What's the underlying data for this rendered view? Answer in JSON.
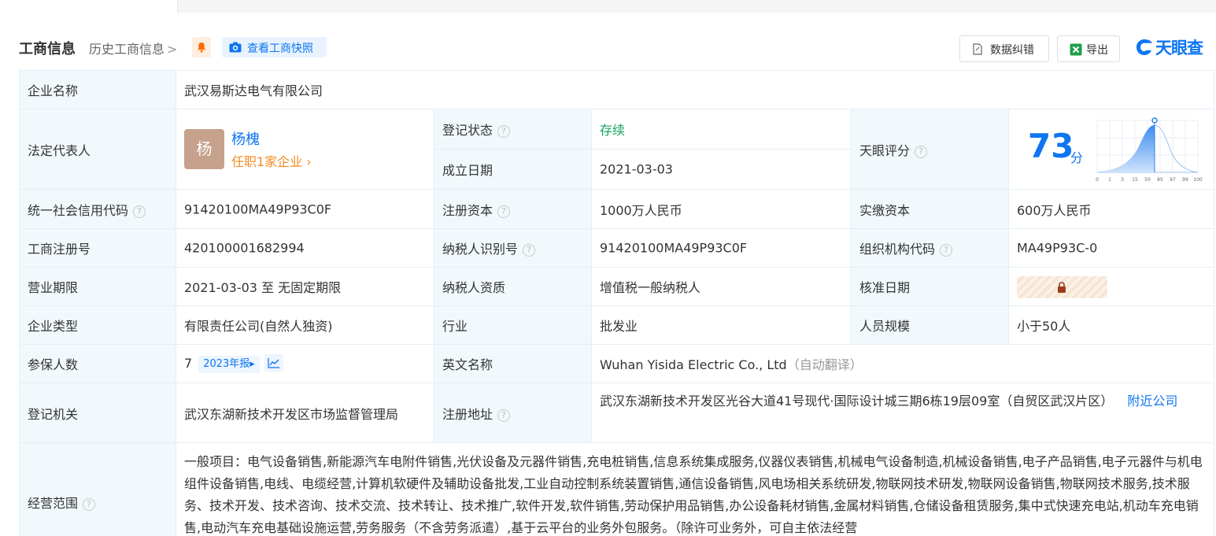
{
  "header": {
    "title": "工商信息",
    "history_link": "历史工商信息",
    "history_chevron": ">",
    "snapshot_button": "查看工商快照",
    "data_correction_button": "数据纠错",
    "export_button": "导出",
    "logo_text": "天眼查"
  },
  "rows": {
    "company_name": {
      "label": "企业名称",
      "value": "武汉易斯达电气有限公司"
    },
    "legal_rep": {
      "label": "法定代表人",
      "avatar_char": "杨",
      "name": "杨槐",
      "positions": "任职1家企业",
      "positions_chevron": "›"
    },
    "reg_status": {
      "label": "登记状态",
      "value": "存续"
    },
    "established": {
      "label": "成立日期",
      "value": "2021-03-03"
    },
    "tianyan_score": {
      "label": "天眼评分",
      "score": "73",
      "unit": "分",
      "axis_ticks": [
        "0",
        "1",
        "3",
        "15",
        "50",
        "85",
        "97",
        "99",
        "100"
      ]
    },
    "credit_code": {
      "label": "统一社会信用代码",
      "value": "91420100MA49P93C0F"
    },
    "reg_capital": {
      "label": "注册资本",
      "value": "1000万人民币"
    },
    "paid_capital": {
      "label": "实缴资本",
      "value": "600万人民币"
    },
    "reg_number": {
      "label": "工商注册号",
      "value": "420100001682994"
    },
    "taxpayer_id": {
      "label": "纳税人识别号",
      "value": "91420100MA49P93C0F"
    },
    "org_code": {
      "label": "组织机构代码",
      "value": "MA49P93C-0"
    },
    "business_term": {
      "label": "营业期限",
      "value": "2021-03-03 至 无固定期限"
    },
    "taxpayer_qual": {
      "label": "纳税人资质",
      "value": "增值税一般纳税人"
    },
    "approval_date": {
      "label": "核准日期"
    },
    "company_type": {
      "label": "企业类型",
      "value": "有限责任公司(自然人独资)"
    },
    "industry": {
      "label": "行业",
      "value": "批发业"
    },
    "staff_size": {
      "label": "人员规模",
      "value": "小于50人"
    },
    "insured": {
      "label": "参保人数",
      "value": "7",
      "report_badge": "2023年报▸"
    },
    "english_name": {
      "label": "英文名称",
      "value": "Wuhan Yisida Electric Co., Ltd",
      "note": "（自动翻译）"
    },
    "reg_authority": {
      "label": "登记机关",
      "value": "武汉东湖新技术开发区市场监督管理局"
    },
    "reg_address": {
      "label": "注册地址",
      "value": "武汉东湖新技术开发区光谷大道41号现代·国际设计城三期6栋19层09室（自贸区武汉片区）",
      "nearby": "附近公司"
    },
    "business_scope": {
      "label": "经营范围",
      "value": "一般项目：电气设备销售,新能源汽车电附件销售,光伏设备及元器件销售,充电桩销售,信息系统集成服务,仪器仪表销售,机械电气设备制造,机械设备销售,电子产品销售,电子元器件与机电组件设备销售,电线、电缆经营,计算机软硬件及辅助设备批发,工业自动控制系统装置销售,通信设备销售,风电场相关系统研发,物联网技术研发,物联网设备销售,物联网技术服务,技术服务、技术开发、技术咨询、技术交流、技术转让、技术推广,软件开发,软件销售,劳动保护用品销售,办公设备耗材销售,金属材料销售,仓储设备租赁服务,集中式快速充电站,机动车充电销售,电动汽车充电基础设施运营,劳务服务（不含劳务派遣）,基于云平台的业务外包服务。（除许可业务外，可自主依法经营"
    }
  },
  "colors": {
    "accent": "#0d75f2",
    "label_bg": "#f2f9fc",
    "status_green": "#14a15f",
    "orange": "#f78a1e"
  }
}
